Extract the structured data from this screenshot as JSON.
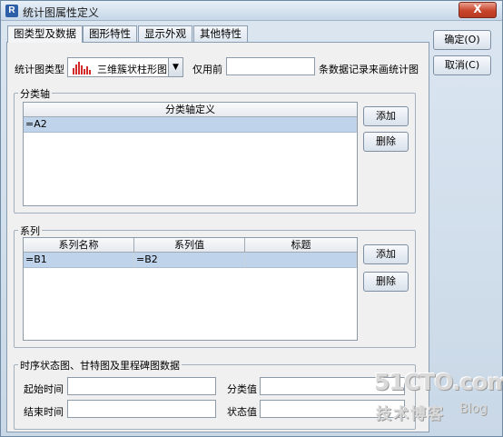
{
  "window": {
    "title": "统计图属性定义",
    "close_label": "X"
  },
  "tabs": [
    {
      "label": "图类型及数据",
      "active": true
    },
    {
      "label": "图形特性",
      "active": false
    },
    {
      "label": "显示外观",
      "active": false
    },
    {
      "label": "其他特性",
      "active": false
    }
  ],
  "side_buttons": {
    "ok": "确定(O)",
    "cancel": "取消(C)"
  },
  "chart_type": {
    "label": "统计图类型",
    "value": "三维簇状柱形图",
    "icon": "bar-chart-icon",
    "icon_color": "#d22a2a"
  },
  "record_limit": {
    "prefix": "仅用前",
    "value": "",
    "suffix": "条数据记录来画统计图"
  },
  "category_axis": {
    "group_title": "分类轴",
    "header": "分类轴定义",
    "rows": [
      "=A2"
    ],
    "add_label": "添加",
    "delete_label": "删除"
  },
  "series": {
    "group_title": "系列",
    "headers": [
      "系列名称",
      "系列值",
      "标题"
    ],
    "rows": [
      [
        "=B1",
        "=B2",
        ""
      ]
    ],
    "add_label": "添加",
    "delete_label": "删除"
  },
  "timeline": {
    "group_title": "时序状态图、甘特图及里程碑图数据",
    "start_label": "起始时间",
    "start_value": "",
    "end_label": "结束时间",
    "end_value": "",
    "category_label": "分类值",
    "category_value": "",
    "status_label": "状态值",
    "status_value": ""
  },
  "watermark": {
    "site": "51CTO.com",
    "tagline": "技术博客",
    "blog": "Blog"
  },
  "colors": {
    "selection": "#bfd3ea",
    "close": "#c8452b"
  }
}
